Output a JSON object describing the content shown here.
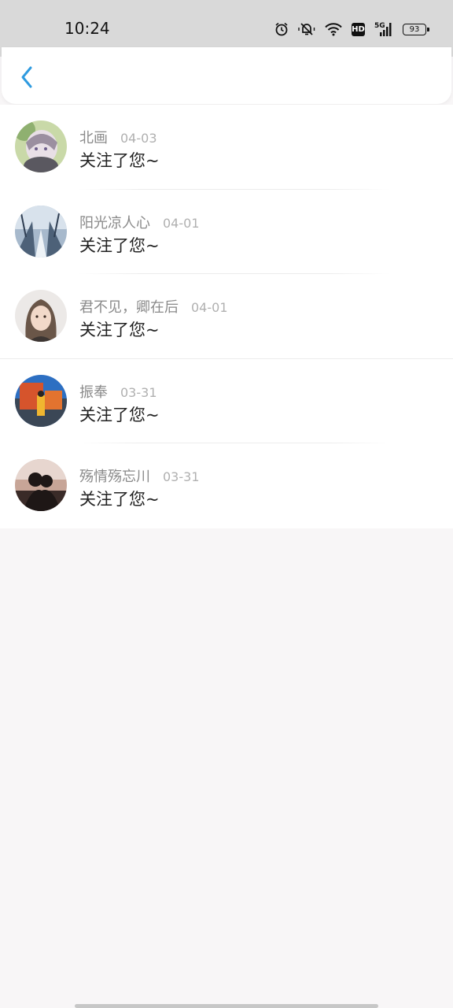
{
  "status_bar": {
    "time": "10:24",
    "network_label": "5G",
    "hd_label": "HD",
    "battery": "93"
  },
  "header": {
    "back_icon": "chevron-left-icon",
    "accent_color": "#2f9be0"
  },
  "notifications": [
    {
      "name": "北画",
      "date": "04-03",
      "message": "关注了您~"
    },
    {
      "name": "阳光凉人心",
      "date": "04-01",
      "message": "关注了您~"
    },
    {
      "name": "君不见，卿在后",
      "date": "04-01",
      "message": "关注了您~"
    },
    {
      "name": "振奉",
      "date": "03-31",
      "message": "关注了您~"
    },
    {
      "name": "殇情殇忘川",
      "date": "03-31",
      "message": "关注了您~"
    }
  ]
}
